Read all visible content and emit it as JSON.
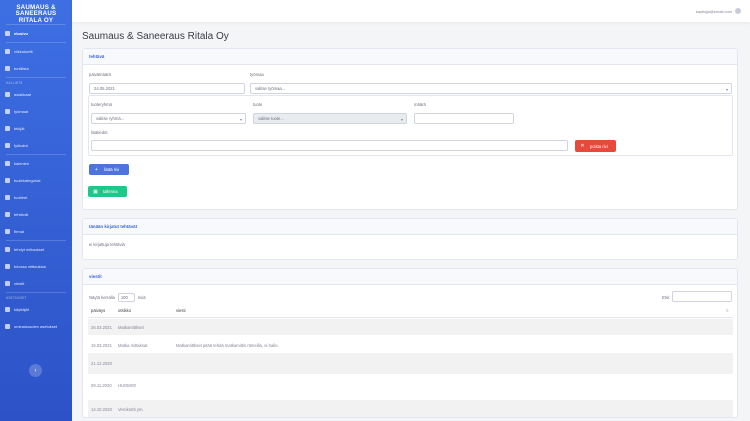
{
  "sidebar": {
    "brand": [
      "SAUMAUS &",
      "SANEERAUS",
      "RITALA OY"
    ],
    "items": [
      {
        "label": "etusivu",
        "icon": "home-icon",
        "active": true
      },
      {
        "label": "viikkokortit",
        "icon": "calendar-icon"
      },
      {
        "label": "tuntilista",
        "icon": "list-icon"
      }
    ],
    "section_hallinta": "HALLINTA",
    "items_hallinta": [
      {
        "label": "asiakkaat",
        "icon": "users-icon"
      },
      {
        "label": "työmaat",
        "icon": "building-icon"
      },
      {
        "label": "tekijät",
        "icon": "user-icon"
      },
      {
        "label": "työkalut",
        "icon": "tools-icon"
      }
    ],
    "items_mid": [
      {
        "label": "kalenteri",
        "icon": "calendar-icon"
      },
      {
        "label": "tuotekategoriat",
        "icon": "folder-icon"
      },
      {
        "label": "tuotteet",
        "icon": "box-icon"
      },
      {
        "label": "tehtävät",
        "icon": "tasks-icon"
      },
      {
        "label": "firmat",
        "icon": "briefcase-icon"
      }
    ],
    "items_low": [
      {
        "label": "tehdyt mittaukset",
        "icon": "ruler-icon"
      },
      {
        "label": "tulossa mittauksia",
        "icon": "clipboard-icon"
      },
      {
        "label": "viestit",
        "icon": "message-icon"
      }
    ],
    "section_asetukset": "ASETUKSET",
    "items_settings": [
      {
        "label": "käyttäjät",
        "icon": "user-cog-icon"
      },
      {
        "label": "ominaisuuden asetukset",
        "icon": "settings-icon"
      }
    ],
    "toggle": "‹"
  },
  "topbar": {
    "user_email": "kayttaja@email.com"
  },
  "page_title": "Saumaus & Saneeraus Ritala Oy",
  "task_card": {
    "header": "tehtävä",
    "date_label": "päivämäärä",
    "date_value": "24.05.2021",
    "site_label": "työmaa",
    "site_value": "valitse työmaa...",
    "group_label": "tuoteryhmä",
    "group_value": "valitse ryhmä...",
    "product_label": "tuote",
    "product_value": "valitse tuote...",
    "qty_label": "määrä",
    "qty_value": "",
    "note_label": "lisätiedot",
    "note_value": "",
    "delete_row": "poista rivi",
    "add_row": "lisää rivi",
    "save": "tallenna"
  },
  "today_card": {
    "header": "tänään kirjatut tehtävät",
    "empty_text": "ei kirjattuja tehtäviä"
  },
  "messages_card": {
    "header": "viestit",
    "show_prefix": "Näytä kerralla",
    "show_count": "100",
    "show_suffix": "riviä",
    "search_label": "Etsi:",
    "columns": [
      "päiväys",
      "otsikko",
      "viesti"
    ],
    "rows": [
      [
        "26.03.2021",
        "Matkamittkset",
        ""
      ],
      [
        "15.03.2021",
        "Matka mittaksat",
        "Matkamittkset pitää tehdä matkamittis rämeilla, ei hallo."
      ],
      [
        "21.12.2020",
        "",
        ""
      ],
      [
        "09.11.2020",
        "HUOMIO!",
        ""
      ],
      [
        "14.10.2020",
        "Verokortit ym.",
        ""
      ]
    ]
  }
}
